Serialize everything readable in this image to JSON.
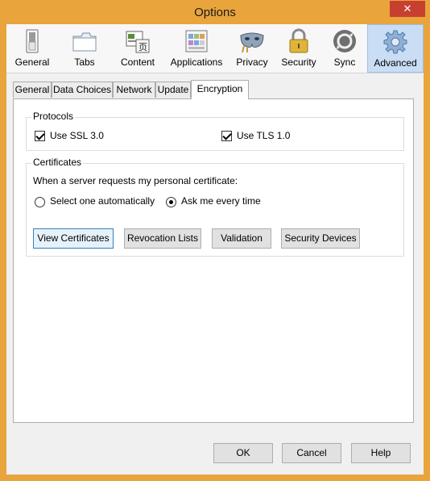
{
  "window": {
    "title": "Options",
    "close_glyph": "✕"
  },
  "panes": [
    {
      "label": "General",
      "icon": "switch-icon"
    },
    {
      "label": "Tabs",
      "icon": "tabs-icon"
    },
    {
      "label": "Content",
      "icon": "content-icon"
    },
    {
      "label": "Applications",
      "icon": "applications-icon"
    },
    {
      "label": "Privacy",
      "icon": "mask-icon"
    },
    {
      "label": "Security",
      "icon": "padlock-icon"
    },
    {
      "label": "Sync",
      "icon": "sync-icon"
    },
    {
      "label": "Advanced",
      "icon": "gear-icon",
      "selected": true
    }
  ],
  "tabs": [
    "General",
    "Data Choices",
    "Network",
    "Update",
    "Encryption"
  ],
  "active_tab": "Encryption",
  "protocols": {
    "caption": "Protocols",
    "ssl_label": "Use SSL 3.0",
    "ssl_checked": true,
    "tls_label": "Use TLS 1.0",
    "tls_checked": true
  },
  "certificates": {
    "caption": "Certificates",
    "prompt": "When a server requests my personal certificate:",
    "option_auto": "Select one automatically",
    "option_ask": "Ask me every time",
    "selected_option": "Ask me every time",
    "buttons": {
      "view": "View Certificates",
      "revocation": "Revocation Lists",
      "validation": "Validation",
      "devices": "Security Devices"
    }
  },
  "footer": {
    "ok": "OK",
    "cancel": "Cancel",
    "help": "Help"
  },
  "colors": {
    "frame": "#e9a43c",
    "selected_pane": "#c9ddf4",
    "close": "#c7402f"
  }
}
